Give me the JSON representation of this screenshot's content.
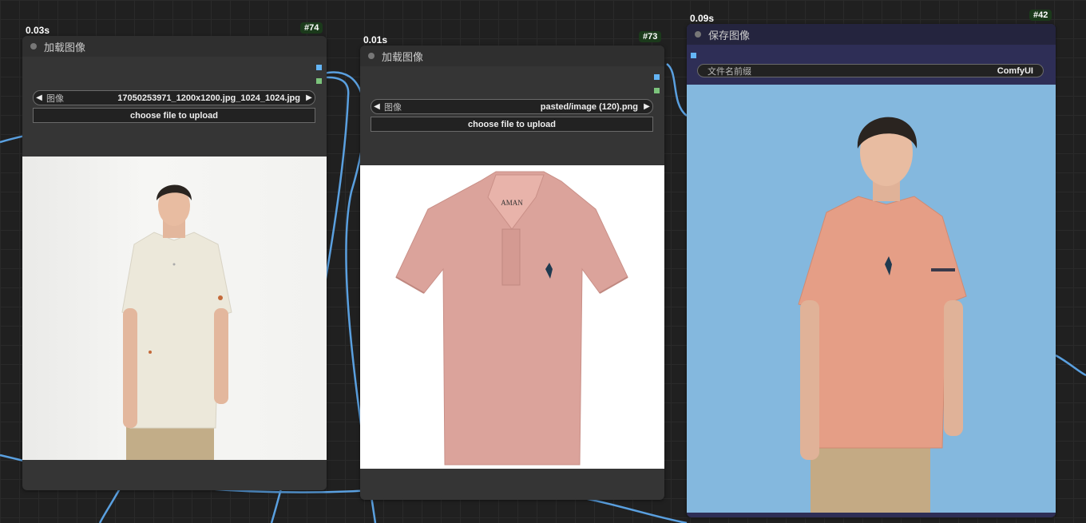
{
  "nodes": [
    {
      "timing": "0.03s",
      "id": "#74",
      "title": "加载图像",
      "image_label": "图像",
      "image_value": "17050253971_1200x1200.jpg_1024_1024.jpg",
      "upload_label": "choose file to upload"
    },
    {
      "timing": "0.01s",
      "id": "#73",
      "title": "加载图像",
      "image_label": "图像",
      "image_value": "pasted/image (120).png",
      "upload_label": "choose file to upload"
    },
    {
      "timing": "0.09s",
      "id": "#42",
      "title": "保存图像",
      "prefix_label": "文件名前缀",
      "prefix_value": "ComfyUI"
    }
  ],
  "colors": {
    "canvas": "#202020",
    "node_body": "#353535",
    "wire": "#5aa0e0",
    "save_header": "#2a2a4a",
    "save_preview_bg": "#84b8de",
    "shirt_pink": "#dba39b",
    "shirt_cream": "#ece8da"
  },
  "icons": [
    "arrow-left-icon",
    "arrow-right-icon",
    "status-dot-icon"
  ]
}
